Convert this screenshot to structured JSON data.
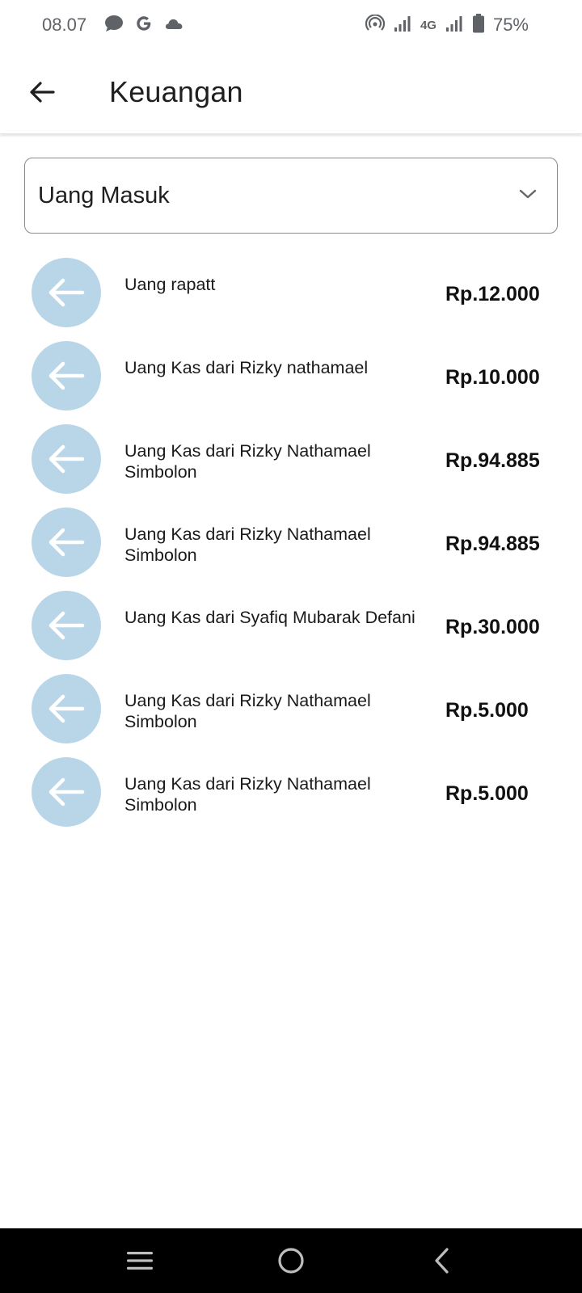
{
  "status_bar": {
    "time": "08.07",
    "network_label": "4G",
    "battery": "75%"
  },
  "app_bar": {
    "title": "Keuangan"
  },
  "filter": {
    "selected": "Uang Masuk"
  },
  "transactions": [
    {
      "description": "Uang rapatt",
      "amount": "Rp.12.000"
    },
    {
      "description": "Uang Kas dari Rizky nathamael",
      "amount": "Rp.10.000"
    },
    {
      "description": "Uang Kas dari Rizky Nathamael Simbolon",
      "amount": "Rp.94.885"
    },
    {
      "description": "Uang Kas dari Rizky Nathamael Simbolon",
      "amount": "Rp.94.885"
    },
    {
      "description": "Uang Kas dari Syafiq Mubarak Defani",
      "amount": "Rp.30.000"
    },
    {
      "description": "Uang Kas dari Rizky Nathamael Simbolon",
      "amount": "Rp.5.000"
    },
    {
      "description": "Uang Kas dari Rizky Nathamael Simbolon",
      "amount": "Rp.5.000"
    }
  ],
  "colors": {
    "avatar_bg": "#b9d6e8",
    "nav_bar_bg": "#000000"
  }
}
